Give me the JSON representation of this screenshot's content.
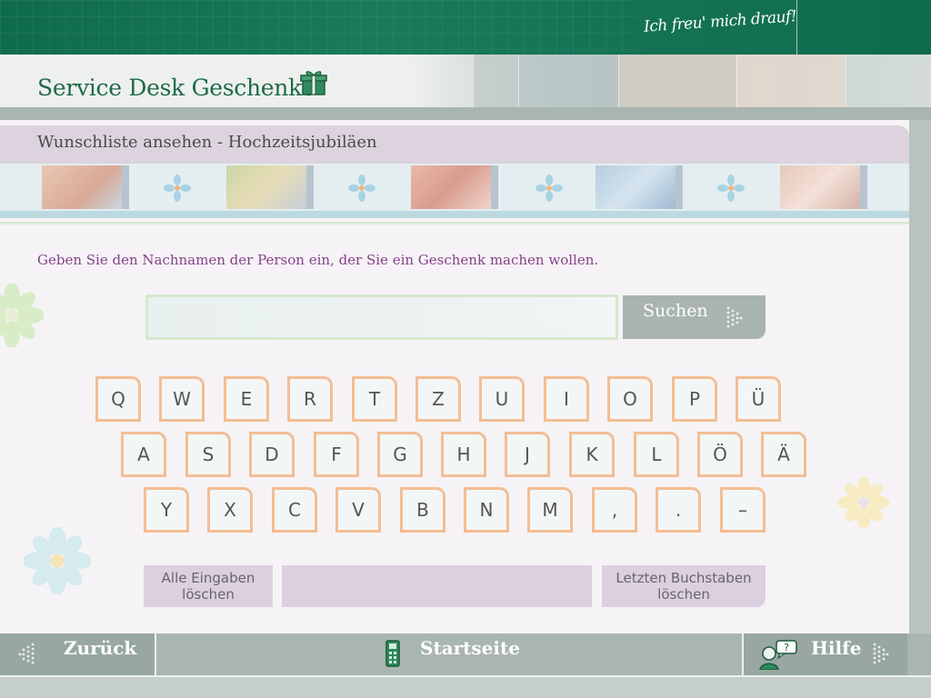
{
  "topbar": {
    "slogan": "Ich freu' mich drauf!"
  },
  "header": {
    "title": "Service Desk Geschenke",
    "icon": "gift-icon"
  },
  "breadcrumb": {
    "text": "Wunschliste ansehen - Hochzeitsjubiläen"
  },
  "instruction": "Geben Sie den Nachnamen der Person ein, der Sie ein Geschenk machen wollen.",
  "search": {
    "value": "",
    "placeholder": "",
    "button_label": "Suchen"
  },
  "keyboard": {
    "row1": [
      "Q",
      "W",
      "E",
      "R",
      "T",
      "Z",
      "U",
      "I",
      "O",
      "P",
      "Ü"
    ],
    "row2": [
      "A",
      "S",
      "D",
      "F",
      "G",
      "H",
      "J",
      "K",
      "L",
      "Ö",
      "Ä"
    ],
    "row3": [
      "Y",
      "X",
      "C",
      "V",
      "B",
      "N",
      "M",
      ",",
      ".",
      "–"
    ]
  },
  "actions": {
    "clear_all_line1": "Alle Eingaben",
    "clear_all_line2": "löschen",
    "delete_last_line1": "Letzten Buchstaben",
    "delete_last_line2": "löschen"
  },
  "footer": {
    "back_label": "Zurück",
    "home_label": "Startseite",
    "help_label": "Hilfe",
    "home_icon": "phone-icon",
    "help_icon": "help-person-icon"
  },
  "colors": {
    "brand_green": "#0f6b4e",
    "title_green": "#1c6a4a",
    "instruction_purple": "#86418a",
    "key_border": "#f2be94"
  }
}
